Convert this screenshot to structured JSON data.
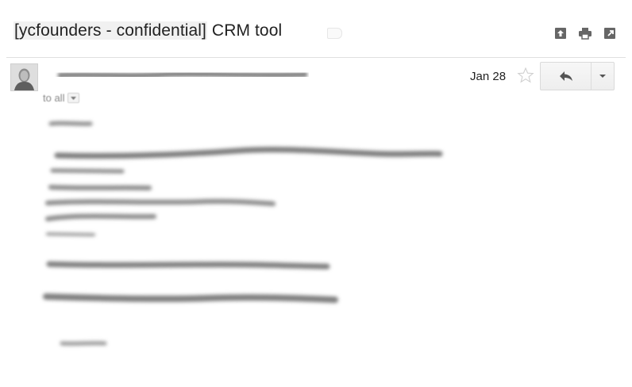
{
  "thread": {
    "subject_label": "[ycfounders - confidential]",
    "subject_text": " CRM tool"
  },
  "icons": {
    "top_actions": [
      "archive-icon",
      "print-icon",
      "new-window-icon"
    ],
    "star": "star-icon",
    "reply": "reply-icon",
    "more": "chevron-down-icon"
  },
  "message": {
    "date": "Jan 28",
    "recipients_label": "to all",
    "sender_redacted": true,
    "body_redacted": true
  },
  "colors": {
    "subject_text": "#222222",
    "label_highlight": "#f1f1f1",
    "divider": "#e0e0e0",
    "redaction_gray": "#8a8a8a"
  }
}
